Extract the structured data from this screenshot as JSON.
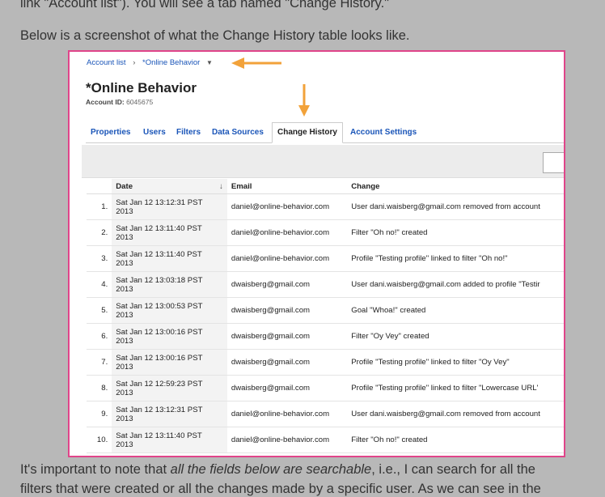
{
  "article": {
    "top_line": "link \"Account list\"). You will see a tab named \"Change History.\"",
    "intro": "Below is a screenshot of what the Change History table looks like.",
    "bottom_pre": "It's important to note that ",
    "bottom_em": "all the fields below are searchable",
    "bottom_post": ", i.e., I can search for all the",
    "bottom_line2": "filters that were created or all the changes made by a specific user. As we can see in the"
  },
  "screenshot": {
    "breadcrumb": {
      "root": "Account list",
      "sep": "›",
      "current": "*Online Behavior"
    },
    "account_title": "*Online Behavior",
    "account_id_label": "Account ID:",
    "account_id": "6045675",
    "tabs": [
      "Properties",
      "Users",
      "Filters",
      "Data Sources",
      "Change History",
      "Account Settings"
    ],
    "active_tab": "Change History",
    "table": {
      "headers": {
        "date": "Date",
        "email": "Email",
        "change": "Change"
      },
      "rows": [
        {
          "n": "1.",
          "date1": "Sat Jan 12 13:12:31 PST",
          "date2": "2013",
          "email": "daniel@online-behavior.com",
          "change": "User dani.waisberg@gmail.com removed from account"
        },
        {
          "n": "2.",
          "date1": "Sat Jan 12 13:11:40 PST",
          "date2": "2013",
          "email": "daniel@online-behavior.com",
          "change": "Filter \"Oh no!\" created"
        },
        {
          "n": "3.",
          "date1": "Sat Jan 12 13:11:40 PST",
          "date2": "2013",
          "email": "daniel@online-behavior.com",
          "change": "Profile \"Testing profile\" linked to filter \"Oh no!\""
        },
        {
          "n": "4.",
          "date1": "Sat Jan 12 13:03:18 PST",
          "date2": "2013",
          "email": "dwaisberg@gmail.com",
          "change": "User dani.waisberg@gmail.com added to profile \"Testir"
        },
        {
          "n": "5.",
          "date1": "Sat Jan 12 13:00:53 PST",
          "date2": "2013",
          "email": "dwaisberg@gmail.com",
          "change": "Goal \"Whoa!\" created"
        },
        {
          "n": "6.",
          "date1": "Sat Jan 12 13:00:16 PST",
          "date2": "2013",
          "email": "dwaisberg@gmail.com",
          "change": "Filter \"Oy Vey\" created"
        },
        {
          "n": "7.",
          "date1": "Sat Jan 12 13:00:16 PST",
          "date2": "2013",
          "email": "dwaisberg@gmail.com",
          "change": "Profile \"Testing profile\" linked to filter \"Oy Vey\""
        },
        {
          "n": "8.",
          "date1": "Sat Jan 12 12:59:23 PST",
          "date2": "2013",
          "email": "dwaisberg@gmail.com",
          "change": "Profile \"Testing profile\" linked to filter \"Lowercase URL'"
        },
        {
          "n": "9.",
          "date1": "Sat Jan 12 13:12:31 PST",
          "date2": "2013",
          "email": "daniel@online-behavior.com",
          "change": "User dani.waisberg@gmail.com removed from account"
        },
        {
          "n": "10.",
          "date1": "Sat Jan 12 13:11:40 PST",
          "date2": "2013",
          "email": "daniel@online-behavior.com",
          "change": "Filter \"Oh no!\" created"
        }
      ]
    }
  },
  "colors": {
    "frame": "#e0458a",
    "arrow": "#f2a23a",
    "link": "#1a55b8",
    "page_bg": "#b8b8b8"
  },
  "icons": {
    "breadcrumb_caret": "caret-down-icon",
    "sort": "sort-down-arrow-icon",
    "annotation": "orange-arrow-icon"
  }
}
